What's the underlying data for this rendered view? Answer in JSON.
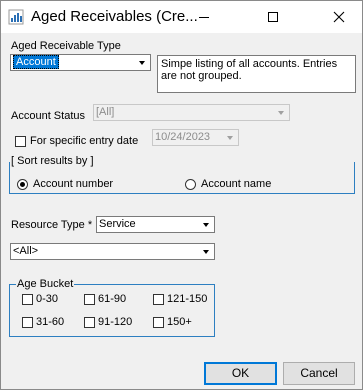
{
  "window": {
    "title": "Aged Receivables (Cre..."
  },
  "receivable_type": {
    "label": "Aged Receivable Type",
    "value": "Account",
    "description": "Simpe listing of all accounts.  Entries are not grouped."
  },
  "account_status": {
    "label": "Account Status",
    "value": "[All]"
  },
  "entry_date": {
    "label": "For specific entry date",
    "checked": false,
    "value": "10/24/2023"
  },
  "sort": {
    "legend": "[ Sort results by ]",
    "options": [
      {
        "label": "Account number",
        "selected": true
      },
      {
        "label": "Account name",
        "selected": false
      }
    ]
  },
  "resource_type": {
    "label": "Resource Type",
    "required_mark": "*",
    "value": "Service"
  },
  "resource_filter": {
    "value": "<All>"
  },
  "age_bucket": {
    "legend": "Age Bucket",
    "items": [
      "0-30",
      "61-90",
      "121-150",
      "31-60",
      "91-120",
      "150+"
    ]
  },
  "buttons": {
    "ok": "OK",
    "cancel": "Cancel"
  }
}
